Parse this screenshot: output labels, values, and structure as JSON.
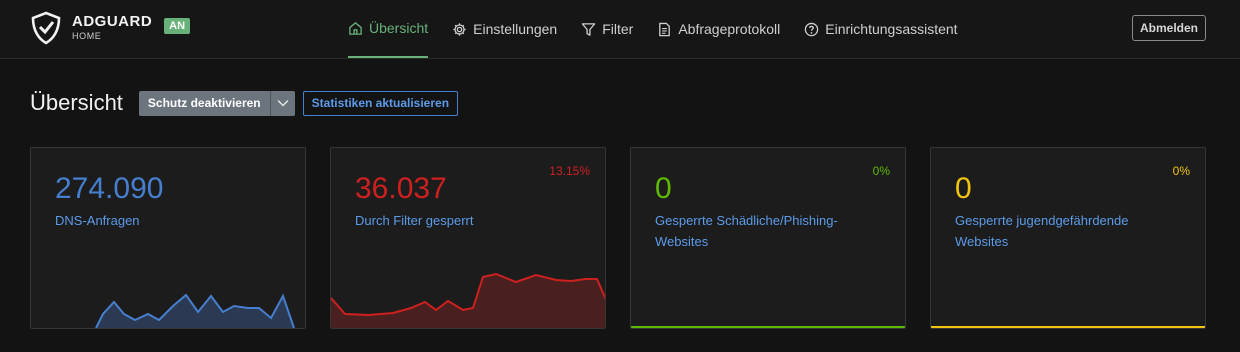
{
  "app": {
    "brand_name": "ADGUARD",
    "brand_sub": "HOME",
    "status_badge": "AN"
  },
  "nav": {
    "items": [
      {
        "label": "Übersicht",
        "icon": "home-icon",
        "active": true
      },
      {
        "label": "Einstellungen",
        "icon": "gear-icon",
        "active": false
      },
      {
        "label": "Filter",
        "icon": "filter-icon",
        "active": false
      },
      {
        "label": "Abfrageprotokoll",
        "icon": "document-icon",
        "active": false
      },
      {
        "label": "Einrichtungsassistent",
        "icon": "help-circle-icon",
        "active": false
      }
    ],
    "logout_label": "Abmelden"
  },
  "page": {
    "title": "Übersicht",
    "protection_button": "Schutz deaktivieren",
    "refresh_button": "Statistiken aktualisieren"
  },
  "cards": [
    {
      "value": "274.090",
      "label": "DNS-Anfragen",
      "percent": "",
      "color": "#467fcf"
    },
    {
      "value": "36.037",
      "label": "Durch Filter gesperrt",
      "percent": "13.15%",
      "color": "#cd201f"
    },
    {
      "value": "0",
      "label": "Gesperrte Schädliche/Phishing-Websites",
      "percent": "0%",
      "color": "#5eba00"
    },
    {
      "value": "0",
      "label": "Gesperrte jugendgefährdende Websites",
      "percent": "0%",
      "color": "#f1c40f"
    }
  ],
  "colors": {
    "accent": "#67b279",
    "link": "#5b9bea",
    "dns": "#467fcf",
    "blocked": "#cd201f",
    "malware": "#5eba00",
    "adult": "#f1c40f"
  }
}
